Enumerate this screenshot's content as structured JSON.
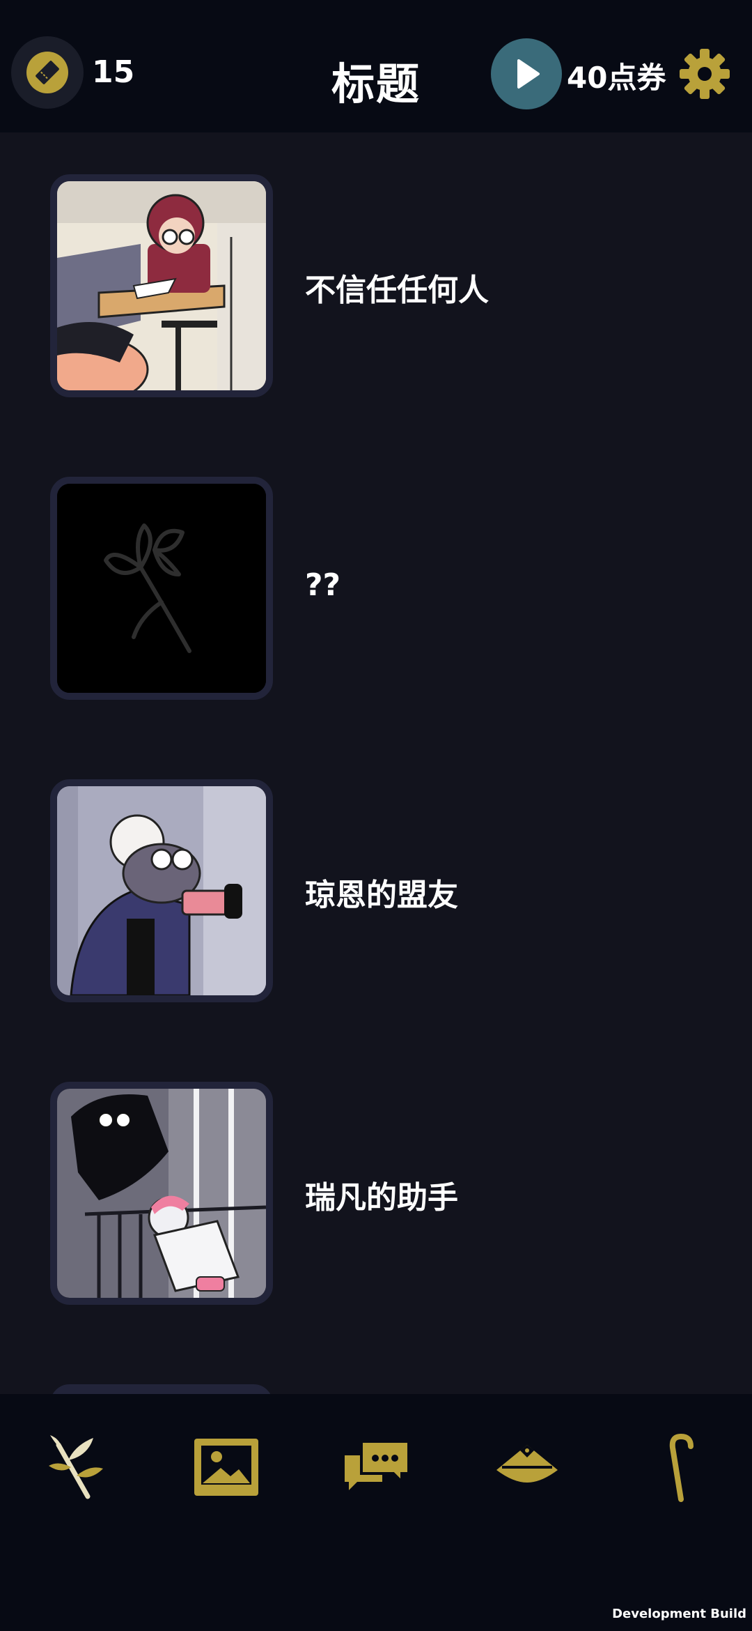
{
  "header": {
    "ticket_count": "15",
    "title": "标题",
    "points_label": "40点券",
    "icons": [
      "ticket-icon",
      "play-icon",
      "gear-icon"
    ]
  },
  "items": [
    {
      "label": "不信任任何人",
      "thumbnail": "girl-at-desk-drawing"
    },
    {
      "label": "??",
      "thumbnail": "dark-flower-silhouette"
    },
    {
      "label": "琼恩的盟友",
      "thumbnail": "old-lady-with-gun"
    },
    {
      "label": "瑞凡的助手",
      "thumbnail": "figures-on-balcony"
    }
  ],
  "bottom_nav": [
    "leaf-branch-icon",
    "gallery-icon",
    "chat-icon",
    "hat-icon",
    "cane-icon"
  ],
  "footer": {
    "build_label": "Development Build"
  },
  "colors": {
    "background": "#12131d",
    "bar": "#070a14",
    "accent_gold": "#b9a13a",
    "play_teal": "#3a6b7a"
  }
}
